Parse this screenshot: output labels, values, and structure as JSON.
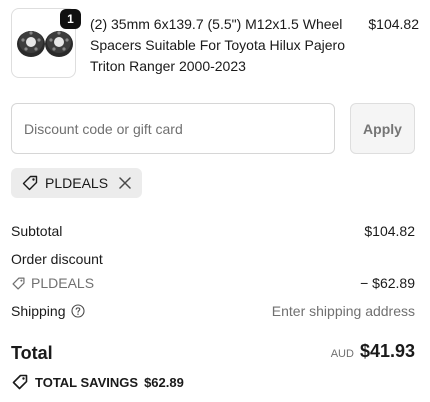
{
  "product": {
    "quantity": "1",
    "title": "(2) 35mm 6x139.7 (5.5\") M12x1.5 Wheel Spacers Suitable For Toyota Hilux Pajero Triton Ranger 2000-2023",
    "price": "$104.82"
  },
  "discount": {
    "placeholder": "Discount code or gift card",
    "value": "",
    "apply_label": "Apply"
  },
  "applied_code": {
    "code": "PLDEALS"
  },
  "summary": {
    "subtotal_label": "Subtotal",
    "subtotal_value": "$104.82",
    "order_discount_label": "Order discount",
    "discount_code": "PLDEALS",
    "discount_value": "− $62.89",
    "shipping_label": "Shipping",
    "shipping_value": "Enter shipping address"
  },
  "total": {
    "label": "Total",
    "currency": "AUD",
    "amount": "$41.93"
  },
  "savings": {
    "label": "TOTAL SAVINGS",
    "amount": "$62.89"
  },
  "colors": {
    "text": "#1a1a1a",
    "muted": "#707070",
    "tag_bg": "#ececec",
    "badge_bg": "#111111"
  }
}
